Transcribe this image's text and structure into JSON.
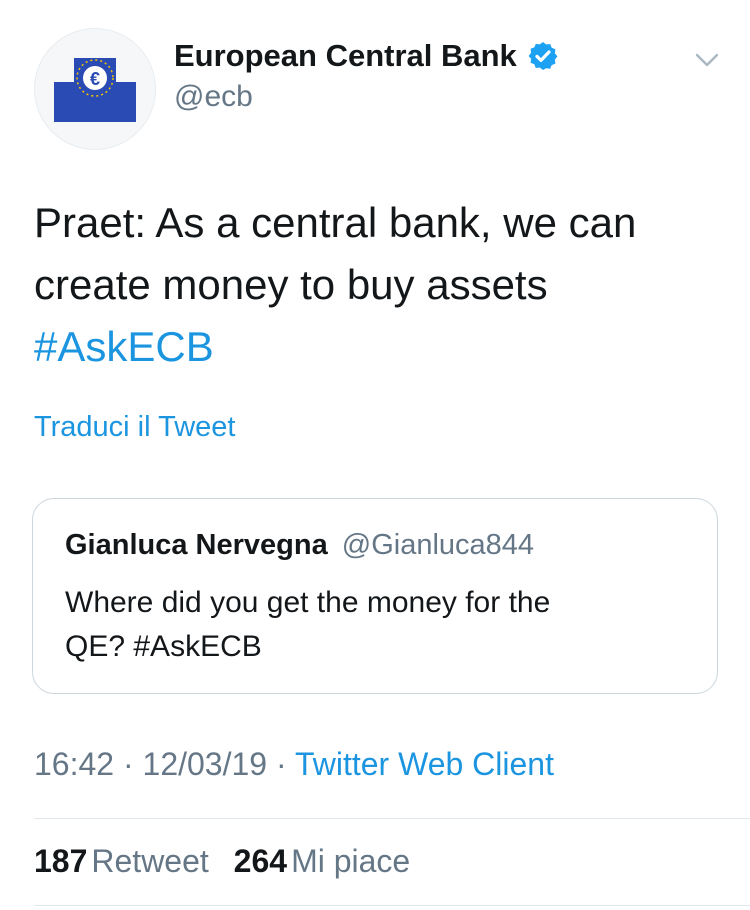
{
  "author": {
    "display_name": "European Central Bank",
    "handle": "@ecb",
    "verified": true,
    "avatar_icon": "ecb-logo-icon"
  },
  "tweet": {
    "text_lines": [
      "Praet: As a central bank, we can",
      "create money to buy assets"
    ],
    "hashtag": "#AskECB",
    "translate_label": "Traduci il Tweet"
  },
  "quoted_tweet": {
    "name": "Gianluca Nervegna",
    "handle": "@Gianluca844",
    "text_line_1": "Where did you get the money for the",
    "text_line_2_prefix": "QE? ",
    "text_line_2_hashtag": "#AskECB"
  },
  "meta": {
    "time": "16:42",
    "separator": "·",
    "date": "12/03/19",
    "client": "Twitter Web Client"
  },
  "stats": {
    "retweets_count": "187",
    "retweets_label": "Retweet",
    "likes_count": "264",
    "likes_label": "Mi piace"
  },
  "colors": {
    "link": "#1b95e0",
    "secondary_text": "#657786",
    "primary_text": "#14171a",
    "ecb_blue": "#2a4bb3",
    "ecb_yellow": "#f5c400",
    "verified_blue": "#1da1f2"
  }
}
